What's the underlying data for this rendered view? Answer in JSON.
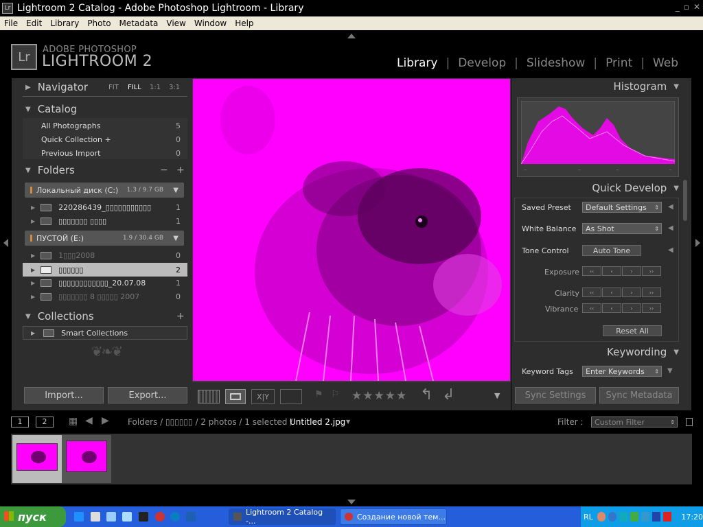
{
  "window": {
    "title": "Lightroom 2 Catalog - Adobe Photoshop Lightroom - Library",
    "icon": "Lr"
  },
  "menu": [
    "File",
    "Edit",
    "Library",
    "Photo",
    "Metadata",
    "View",
    "Window",
    "Help"
  ],
  "brand": {
    "top": "ADOBE PHOTOSHOP",
    "name": "LIGHTROOM 2",
    "logo": "Lr"
  },
  "modules": [
    "Library",
    "Develop",
    "Slideshow",
    "Print",
    "Web"
  ],
  "navigator": {
    "title": "Navigator",
    "fit": "FIT",
    "fill": "FILL",
    "r1": "1:1",
    "r3": "3:1"
  },
  "catalog": {
    "title": "Catalog",
    "items": [
      {
        "label": "All Photographs",
        "count": "5"
      },
      {
        "label": "Quick Collection +",
        "count": "0"
      },
      {
        "label": "Previous Import",
        "count": "0"
      }
    ]
  },
  "folders": {
    "title": "Folders",
    "volumes": [
      {
        "name": "Локальный диск (C:)",
        "size": "1.3 / 9.7 GB",
        "items": [
          {
            "label": "220286439_▯▯▯▯▯▯▯▯▯▯▯",
            "count": "1"
          },
          {
            "label": "▯▯▯▯▯▯▯ ▯▯▯▯",
            "count": "1"
          }
        ]
      },
      {
        "name": "ПУСТОЙ (E:)",
        "size": "1.9 / 30.4 GB",
        "items": [
          {
            "label": "1▯▯▯2008",
            "count": "0"
          },
          {
            "label": "▯▯▯▯▯▯",
            "count": "2"
          },
          {
            "label": "▯▯▯▯▯▯▯▯▯▯▯▯_20.07.08",
            "count": "1"
          },
          {
            "label": "▯▯▯▯▯▯▯ 8 ▯▯▯▯▯ 2007",
            "count": "0"
          }
        ]
      }
    ]
  },
  "collections": {
    "title": "Collections",
    "smart": "Smart Collections"
  },
  "buttons": {
    "import": "Import...",
    "export": "Export...",
    "sync_settings": "Sync Settings",
    "sync_metadata": "Sync Metadata"
  },
  "histogram": {
    "title": "Histogram"
  },
  "quick_develop": {
    "title": "Quick Develop",
    "saved_preset_label": "Saved Preset",
    "saved_preset_value": "Default Settings",
    "white_balance_label": "White Balance",
    "white_balance_value": "As Shot",
    "tone_control_label": "Tone Control",
    "auto_tone": "Auto Tone",
    "exposure": "Exposure",
    "clarity": "Clarity",
    "vibrance": "Vibrance",
    "reset_all": "Reset All"
  },
  "keywording": {
    "title": "Keywording",
    "tags_label": "Keyword Tags",
    "tags_value": "Enter Keywords"
  },
  "toolbar": {
    "xy": "X|Y",
    "rating": "★★★★★"
  },
  "filmstrip": {
    "view1": "1",
    "view2": "2",
    "path_prefix": "Folders / ▯▯▯▯▯▯ / 2 photos / 1 selected /",
    "current_file": "Untitled 2.jpg",
    "filter_label": "Filter :",
    "filter_value": "Custom Filter"
  },
  "taskbar": {
    "start": "пуск",
    "tasks": [
      "Lightroom 2 Catalog -...",
      "Создание новой тем..."
    ],
    "lang": "RL",
    "clock": "17:20"
  },
  "colors": {
    "photo": "#ff00ff",
    "panel": "#2d2d2d"
  }
}
